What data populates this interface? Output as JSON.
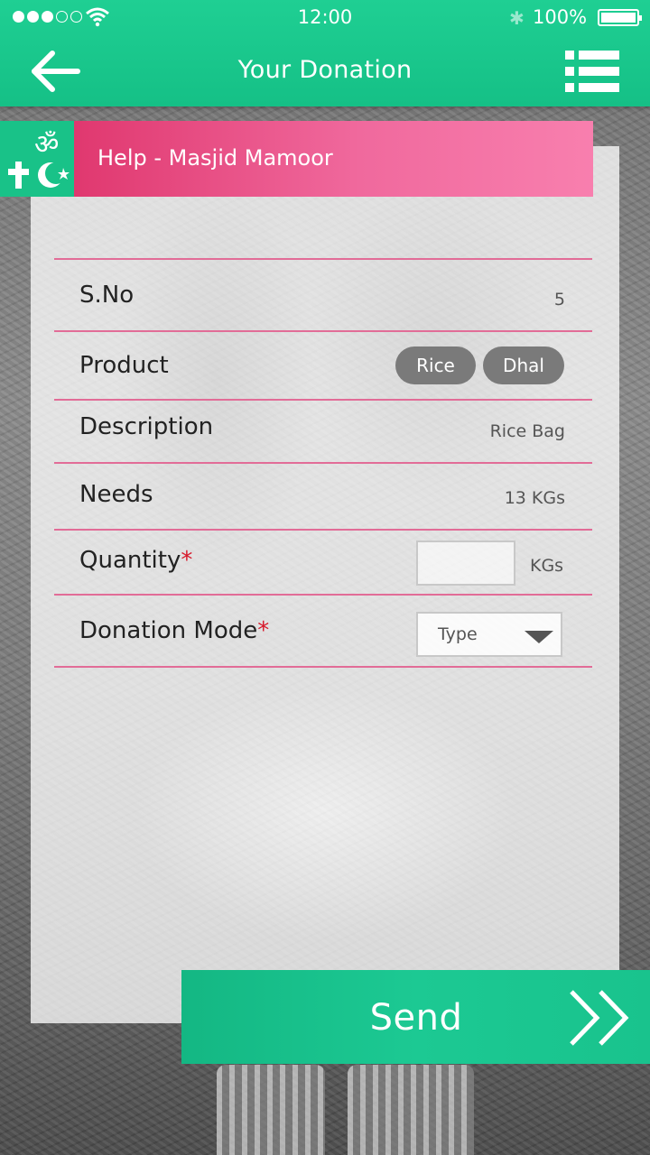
{
  "status_bar": {
    "time": "12:00",
    "battery": "100%"
  },
  "header": {
    "title": "Your Donation",
    "back_icon": "arrow-left-icon",
    "menu_icon": "list-icon"
  },
  "card": {
    "title": "Help - Masjid Mamoor",
    "badge_icon": "religion-symbols-icon",
    "badge_color": "#19c288",
    "banner_colors": [
      "#e0386f",
      "#f87fae"
    ],
    "rows": {
      "sno": {
        "label": "S.No",
        "value": "5"
      },
      "product": {
        "label": "Product",
        "chips": [
          "Rice",
          "Dhal"
        ]
      },
      "description": {
        "label": "Description",
        "value": "Rice Bag"
      },
      "needs": {
        "label": "Needs",
        "value": "13 KGs"
      },
      "quantity": {
        "label": "Quantity",
        "required": "*",
        "value": "",
        "unit": "KGs"
      },
      "donation_mode": {
        "label": "Donation Mode",
        "required": "*",
        "selected": "Type"
      }
    }
  },
  "send": {
    "label": "Send",
    "icon": "double-chevron-right-icon",
    "color": "#1cc993"
  },
  "colors": {
    "accent": "#1cc993",
    "divider": "#e26c97",
    "required": "#d7192b"
  }
}
